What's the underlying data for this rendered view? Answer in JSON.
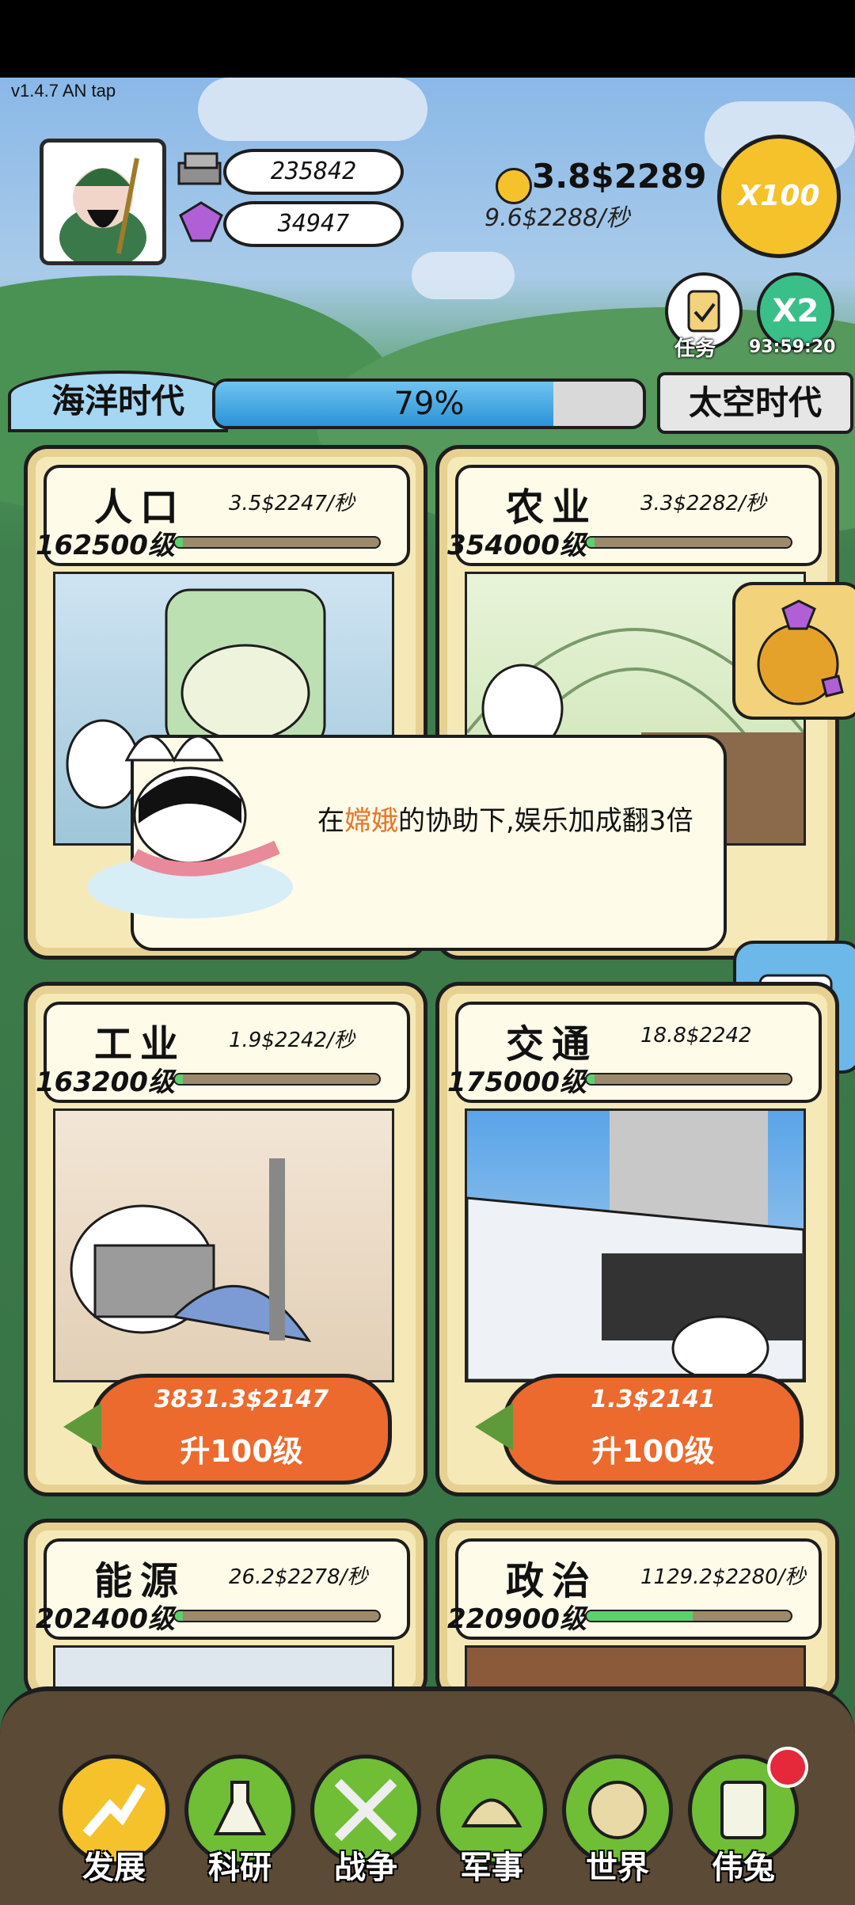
{
  "version": "v1.4.7 AN tap",
  "resources": {
    "ingots": "235842",
    "gems": "34947"
  },
  "money": {
    "total": "3.8$2289",
    "rate": "9.6$2288/秒"
  },
  "multiplier_button": "X100",
  "tasks": {
    "label": "任务"
  },
  "boost": {
    "icon_text": "X2",
    "timer": "93:59:20"
  },
  "era": {
    "current": "海洋时代",
    "next": "太空时代",
    "progress_text": "79%",
    "progress_value": 79
  },
  "cards": [
    {
      "title": "人口",
      "rate": "3.5$2247/秒",
      "level": "162500级",
      "progress": 0.04
    },
    {
      "title": "农业",
      "rate": "3.3$2282/秒",
      "level": "354000级",
      "progress": 0.04
    },
    {
      "title": "工业",
      "rate": "1.9$2242/秒",
      "level": "163200级",
      "progress": 0.04,
      "cost": "3831.3$2147",
      "upgrade": "升100级"
    },
    {
      "title": "交通",
      "rate": "18.8$2242",
      "level": "175000级",
      "progress": 0.04,
      "cost": "1.3$2141",
      "upgrade": "升100级"
    },
    {
      "title": "能源",
      "rate": "26.2$2278/秒",
      "level": "202400级",
      "progress": 0.04
    },
    {
      "title": "政治",
      "rate": "1129.2$2280/秒",
      "level": "220900级",
      "progress": 0.52
    }
  ],
  "tooltip": {
    "prefix": "在",
    "highlight": "嫦娥",
    "suffix": "的协助下,娱乐加成翻3倍"
  },
  "nav": [
    {
      "label": "发展",
      "icon": "arrow-up-icon",
      "active": true
    },
    {
      "label": "科研",
      "icon": "flask-icon"
    },
    {
      "label": "战争",
      "icon": "crossed-swords-icon"
    },
    {
      "label": "军事",
      "icon": "helmet-icon"
    },
    {
      "label": "世界",
      "icon": "globe-icon"
    },
    {
      "label": "伟兔",
      "icon": "book-icon",
      "badge": true
    }
  ],
  "colors": {
    "gold": "#f5c22b",
    "nav_green": "#6fbe35",
    "carrot": "#ec6a2e",
    "progress_blue": "#2b93d7",
    "highlight": "#e8762a"
  }
}
